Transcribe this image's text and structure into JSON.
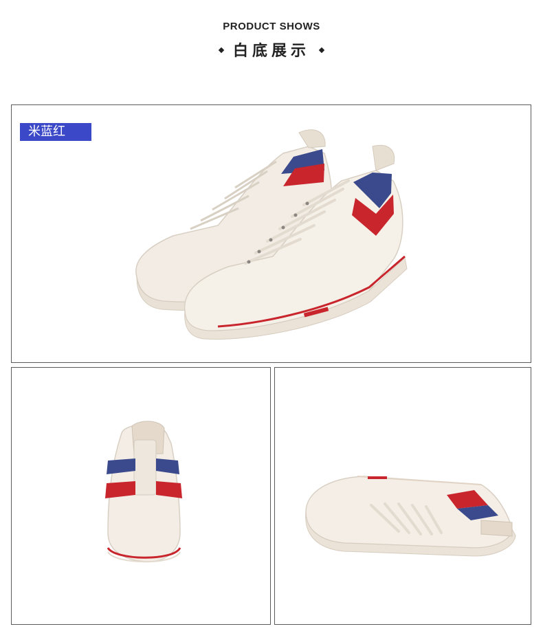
{
  "header": {
    "title_en": "PRODUCT SHOWS",
    "title_zh": "白底展示"
  },
  "panels": {
    "main": {
      "color_tag": "米蓝红"
    }
  },
  "icons": {
    "bullet_left": "diamond-bullet-icon",
    "bullet_right": "diamond-bullet-icon"
  },
  "colors": {
    "tag_bg": "#3b48c7",
    "stripe_blue": "#3a4a8c",
    "stripe_red": "#c8252d",
    "shoe_cream": "#efe8df"
  }
}
